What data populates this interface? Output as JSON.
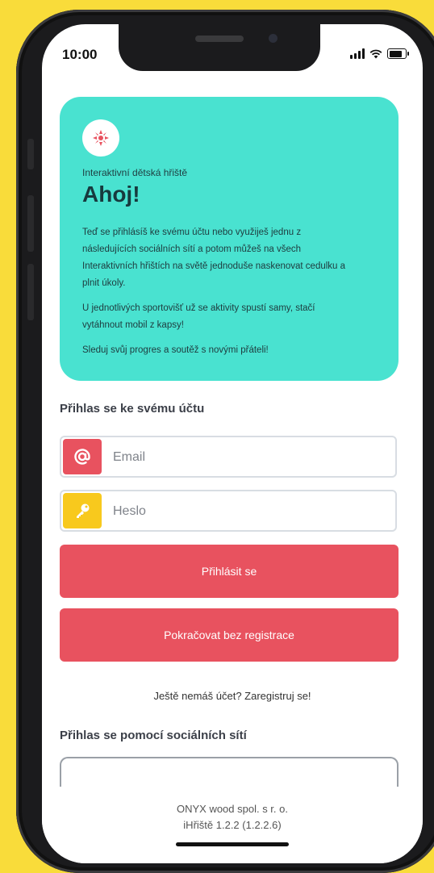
{
  "status_bar": {
    "time": "10:00"
  },
  "hero": {
    "logo_icon": "playground-logo-icon",
    "subtitle": "Interaktivní dětská hřiště",
    "title": "Ahoj!",
    "paragraphs": [
      "Teď se přihlásíš ke svému účtu nebo využiješ jednu z následujících sociálních sítí a potom můžeš na všech Interaktivních hřištích na světě jednoduše naskenovat cedulku a plnit úkoly.",
      "U jednotlivých sportovišť už se aktivity spustí samy, stačí vytáhnout mobil z kapsy!",
      "Sleduj svůj progres a soutěž s novými přáteli!"
    ]
  },
  "login": {
    "section_title": "Přihlas se ke svému účtu",
    "email_placeholder": "Email",
    "password_placeholder": "Heslo",
    "login_button": "Přihlásit se",
    "guest_button": "Pokračovat bez registrace",
    "register_link": "Ještě nemáš účet? Zaregistruj se!"
  },
  "social": {
    "section_title": "Přihlas se pomocí sociálních sítí"
  },
  "footer": {
    "company": "ONYX wood spol. s r. o.",
    "version": "iHřiště 1.2.2 (1.2.2.6)"
  },
  "colors": {
    "background": "#F9DC3A",
    "hero": "#49E2D0",
    "accent": "#E8525F",
    "key": "#F8C91D"
  }
}
